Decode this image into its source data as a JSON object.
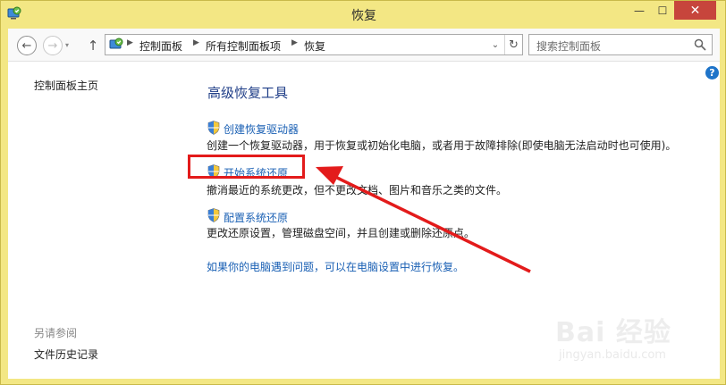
{
  "window": {
    "title": "恢复",
    "minimize_glyph": "—",
    "maximize_glyph": "☐",
    "close_glyph": "✕"
  },
  "nav": {
    "back_glyph": "←",
    "forward_glyph": "→",
    "up_glyph": "↑",
    "recent_glyph": "▾",
    "breadcrumbs": [
      "控制面板",
      "所有控制面板项",
      "恢复"
    ],
    "refresh_glyph": "↻",
    "dropdown_glyph": "⌄",
    "search_placeholder": "搜索控制面板"
  },
  "sidebar": {
    "home_label": "控制面板主页",
    "see_also_label": "另请参阅",
    "file_history_label": "文件历史记录"
  },
  "main": {
    "heading": "高级恢复工具",
    "tools": [
      {
        "label": "创建恢复驱动器",
        "desc": "创建一个恢复驱动器，用于恢复或初始化电脑，或者用于故障排除(即使电脑无法启动时也可使用)。"
      },
      {
        "label": "开始系统还原",
        "desc": "撤消最近的系统更改，但不更改文档、图片和音乐之类的文件。"
      },
      {
        "label": "配置系统还原",
        "desc": "更改还原设置，管理磁盘空间，并且创建或删除还原点。"
      }
    ],
    "footer_link": "如果你的电脑遇到问题，可以在电脑设置中进行恢复。",
    "help_glyph": "?"
  },
  "watermark": {
    "main": "Bai 经验",
    "sub": "jingyan.baidu.com"
  },
  "colors": {
    "frame": "#f3e784",
    "link": "#1a60b4",
    "heading": "#1e3d87",
    "annotation": "#e31b1b",
    "close_button": "#c7453c"
  }
}
